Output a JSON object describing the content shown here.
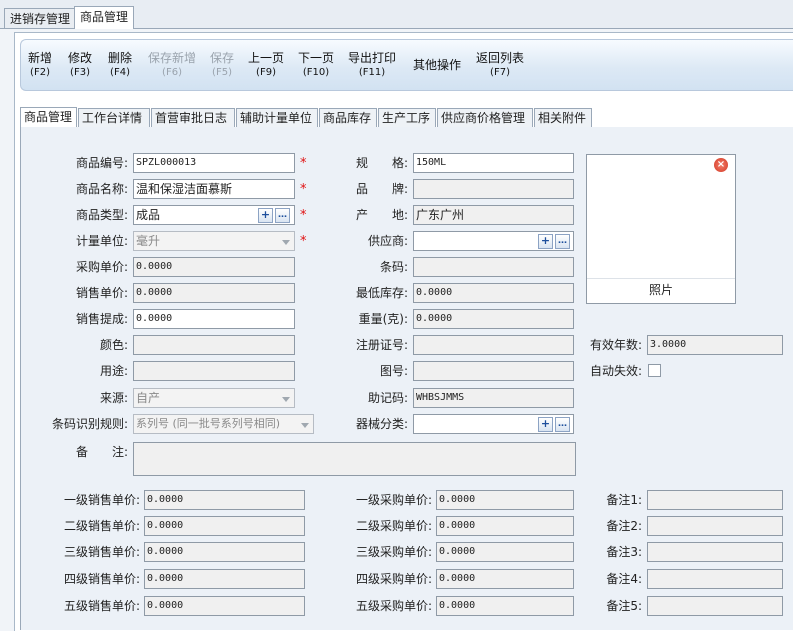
{
  "top_tabs": [
    "进销存管理",
    "商品管理"
  ],
  "toolbar": [
    {
      "label": "新增",
      "key": "(F2)",
      "enabled": true
    },
    {
      "label": "修改",
      "key": "(F3)",
      "enabled": true
    },
    {
      "label": "删除",
      "key": "(F4)",
      "enabled": true
    },
    {
      "label": "保存新增",
      "key": "(F6)",
      "enabled": false
    },
    {
      "label": "保存",
      "key": "(F5)",
      "enabled": false
    },
    {
      "label": "上一页",
      "key": "(F9)",
      "enabled": true
    },
    {
      "label": "下一页",
      "key": "(F10)",
      "enabled": true
    },
    {
      "label": "导出打印",
      "key": "(F11)",
      "enabled": true
    },
    {
      "label": "其他操作",
      "key": "",
      "enabled": true
    },
    {
      "label": "返回列表",
      "key": "(F7)",
      "enabled": true
    }
  ],
  "sub_tabs": [
    "商品管理",
    "工作台详情",
    "首营审批日志",
    "辅助计量单位",
    "商品库存",
    "生产工序",
    "供应商价格管理",
    "相关附件"
  ],
  "form": {
    "code_label": "商品编号:",
    "code": "SPZL000013",
    "name_label": "商品名称:",
    "name": "温和保湿洁面慕斯",
    "type_label": "商品类型:",
    "type": "成品",
    "unit_label": "计量单位:",
    "unit": "毫升",
    "purchase_price_label": "采购单价:",
    "purchase_price": "0.0000",
    "sale_price_label": "销售单价:",
    "sale_price": "0.0000",
    "commission_label": "销售提成:",
    "commission": "0.0000",
    "color_label": "颜色:",
    "color": "",
    "usage_label": "用途:",
    "usage": "",
    "source_label": "来源:",
    "source": "自产",
    "barcode_rule_label": "条码识别规则:",
    "barcode_rule": "系列号 (同一批号系列号相同)",
    "remark_label": "备　　注:",
    "remark": "",
    "spec_label": "规　　格:",
    "spec": "150ML",
    "brand_label": "品　　牌:",
    "brand": "",
    "origin_label": "产　　地:",
    "origin": "广东广州",
    "supplier_label": "供应商:",
    "supplier": "",
    "barcode_label": "条码:",
    "barcode": "",
    "min_stock_label": "最低库存:",
    "min_stock": "0.0000",
    "weight_label": "重量(克):",
    "weight": "0.0000",
    "reg_no_label": "注册证号:",
    "reg_no": "",
    "drawing_no_label": "图号:",
    "drawing_no": "",
    "mnemonic_label": "助记码:",
    "mnemonic": "WHBSJMMS",
    "device_class_label": "器械分类:",
    "device_class": "",
    "photo_label": "照片",
    "valid_years_label": "有效年数:",
    "valid_years": "3.0000",
    "auto_expire_label": "自动失效:"
  },
  "prices": {
    "sale": [
      {
        "label": "一级销售单价:",
        "value": "0.0000"
      },
      {
        "label": "二级销售单价:",
        "value": "0.0000"
      },
      {
        "label": "三级销售单价:",
        "value": "0.0000"
      },
      {
        "label": "四级销售单价:",
        "value": "0.0000"
      },
      {
        "label": "五级销售单价:",
        "value": "0.0000"
      }
    ],
    "purchase": [
      {
        "label": "一级采购单价:",
        "value": "0.0000"
      },
      {
        "label": "二级采购单价:",
        "value": "0.0000"
      },
      {
        "label": "三级采购单价:",
        "value": "0.0000"
      },
      {
        "label": "四级采购单价:",
        "value": "0.0000"
      },
      {
        "label": "五级采购单价:",
        "value": "0.0000"
      }
    ],
    "notes": [
      {
        "label": "备注1:",
        "value": ""
      },
      {
        "label": "备注2:",
        "value": ""
      },
      {
        "label": "备注3:",
        "value": ""
      },
      {
        "label": "备注4:",
        "value": ""
      },
      {
        "label": "备注5:",
        "value": ""
      }
    ]
  }
}
